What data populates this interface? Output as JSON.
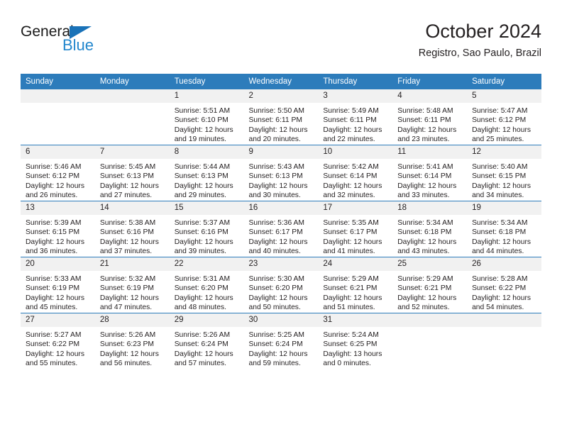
{
  "brand": {
    "name_top": "General",
    "name_bottom": "Blue"
  },
  "header": {
    "title": "October 2024",
    "subtitle": "Registro, Sao Paulo, Brazil"
  },
  "colors": {
    "header_blue": "#2d7cbb",
    "logo_blue": "#2387cd",
    "daynum_band": "#f1f1f1",
    "text": "#231f20"
  },
  "weekdays": [
    "Sunday",
    "Monday",
    "Tuesday",
    "Wednesday",
    "Thursday",
    "Friday",
    "Saturday"
  ],
  "weeks": [
    [
      {
        "day": "",
        "sunrise": "",
        "sunset": "",
        "daylight1": "",
        "daylight2": ""
      },
      {
        "day": "",
        "sunrise": "",
        "sunset": "",
        "daylight1": "",
        "daylight2": ""
      },
      {
        "day": "1",
        "sunrise": "Sunrise: 5:51 AM",
        "sunset": "Sunset: 6:10 PM",
        "daylight1": "Daylight: 12 hours",
        "daylight2": "and 19 minutes."
      },
      {
        "day": "2",
        "sunrise": "Sunrise: 5:50 AM",
        "sunset": "Sunset: 6:11 PM",
        "daylight1": "Daylight: 12 hours",
        "daylight2": "and 20 minutes."
      },
      {
        "day": "3",
        "sunrise": "Sunrise: 5:49 AM",
        "sunset": "Sunset: 6:11 PM",
        "daylight1": "Daylight: 12 hours",
        "daylight2": "and 22 minutes."
      },
      {
        "day": "4",
        "sunrise": "Sunrise: 5:48 AM",
        "sunset": "Sunset: 6:11 PM",
        "daylight1": "Daylight: 12 hours",
        "daylight2": "and 23 minutes."
      },
      {
        "day": "5",
        "sunrise": "Sunrise: 5:47 AM",
        "sunset": "Sunset: 6:12 PM",
        "daylight1": "Daylight: 12 hours",
        "daylight2": "and 25 minutes."
      }
    ],
    [
      {
        "day": "6",
        "sunrise": "Sunrise: 5:46 AM",
        "sunset": "Sunset: 6:12 PM",
        "daylight1": "Daylight: 12 hours",
        "daylight2": "and 26 minutes."
      },
      {
        "day": "7",
        "sunrise": "Sunrise: 5:45 AM",
        "sunset": "Sunset: 6:13 PM",
        "daylight1": "Daylight: 12 hours",
        "daylight2": "and 27 minutes."
      },
      {
        "day": "8",
        "sunrise": "Sunrise: 5:44 AM",
        "sunset": "Sunset: 6:13 PM",
        "daylight1": "Daylight: 12 hours",
        "daylight2": "and 29 minutes."
      },
      {
        "day": "9",
        "sunrise": "Sunrise: 5:43 AM",
        "sunset": "Sunset: 6:13 PM",
        "daylight1": "Daylight: 12 hours",
        "daylight2": "and 30 minutes."
      },
      {
        "day": "10",
        "sunrise": "Sunrise: 5:42 AM",
        "sunset": "Sunset: 6:14 PM",
        "daylight1": "Daylight: 12 hours",
        "daylight2": "and 32 minutes."
      },
      {
        "day": "11",
        "sunrise": "Sunrise: 5:41 AM",
        "sunset": "Sunset: 6:14 PM",
        "daylight1": "Daylight: 12 hours",
        "daylight2": "and 33 minutes."
      },
      {
        "day": "12",
        "sunrise": "Sunrise: 5:40 AM",
        "sunset": "Sunset: 6:15 PM",
        "daylight1": "Daylight: 12 hours",
        "daylight2": "and 34 minutes."
      }
    ],
    [
      {
        "day": "13",
        "sunrise": "Sunrise: 5:39 AM",
        "sunset": "Sunset: 6:15 PM",
        "daylight1": "Daylight: 12 hours",
        "daylight2": "and 36 minutes."
      },
      {
        "day": "14",
        "sunrise": "Sunrise: 5:38 AM",
        "sunset": "Sunset: 6:16 PM",
        "daylight1": "Daylight: 12 hours",
        "daylight2": "and 37 minutes."
      },
      {
        "day": "15",
        "sunrise": "Sunrise: 5:37 AM",
        "sunset": "Sunset: 6:16 PM",
        "daylight1": "Daylight: 12 hours",
        "daylight2": "and 39 minutes."
      },
      {
        "day": "16",
        "sunrise": "Sunrise: 5:36 AM",
        "sunset": "Sunset: 6:17 PM",
        "daylight1": "Daylight: 12 hours",
        "daylight2": "and 40 minutes."
      },
      {
        "day": "17",
        "sunrise": "Sunrise: 5:35 AM",
        "sunset": "Sunset: 6:17 PM",
        "daylight1": "Daylight: 12 hours",
        "daylight2": "and 41 minutes."
      },
      {
        "day": "18",
        "sunrise": "Sunrise: 5:34 AM",
        "sunset": "Sunset: 6:18 PM",
        "daylight1": "Daylight: 12 hours",
        "daylight2": "and 43 minutes."
      },
      {
        "day": "19",
        "sunrise": "Sunrise: 5:34 AM",
        "sunset": "Sunset: 6:18 PM",
        "daylight1": "Daylight: 12 hours",
        "daylight2": "and 44 minutes."
      }
    ],
    [
      {
        "day": "20",
        "sunrise": "Sunrise: 5:33 AM",
        "sunset": "Sunset: 6:19 PM",
        "daylight1": "Daylight: 12 hours",
        "daylight2": "and 45 minutes."
      },
      {
        "day": "21",
        "sunrise": "Sunrise: 5:32 AM",
        "sunset": "Sunset: 6:19 PM",
        "daylight1": "Daylight: 12 hours",
        "daylight2": "and 47 minutes."
      },
      {
        "day": "22",
        "sunrise": "Sunrise: 5:31 AM",
        "sunset": "Sunset: 6:20 PM",
        "daylight1": "Daylight: 12 hours",
        "daylight2": "and 48 minutes."
      },
      {
        "day": "23",
        "sunrise": "Sunrise: 5:30 AM",
        "sunset": "Sunset: 6:20 PM",
        "daylight1": "Daylight: 12 hours",
        "daylight2": "and 50 minutes."
      },
      {
        "day": "24",
        "sunrise": "Sunrise: 5:29 AM",
        "sunset": "Sunset: 6:21 PM",
        "daylight1": "Daylight: 12 hours",
        "daylight2": "and 51 minutes."
      },
      {
        "day": "25",
        "sunrise": "Sunrise: 5:29 AM",
        "sunset": "Sunset: 6:21 PM",
        "daylight1": "Daylight: 12 hours",
        "daylight2": "and 52 minutes."
      },
      {
        "day": "26",
        "sunrise": "Sunrise: 5:28 AM",
        "sunset": "Sunset: 6:22 PM",
        "daylight1": "Daylight: 12 hours",
        "daylight2": "and 54 minutes."
      }
    ],
    [
      {
        "day": "27",
        "sunrise": "Sunrise: 5:27 AM",
        "sunset": "Sunset: 6:22 PM",
        "daylight1": "Daylight: 12 hours",
        "daylight2": "and 55 minutes."
      },
      {
        "day": "28",
        "sunrise": "Sunrise: 5:26 AM",
        "sunset": "Sunset: 6:23 PM",
        "daylight1": "Daylight: 12 hours",
        "daylight2": "and 56 minutes."
      },
      {
        "day": "29",
        "sunrise": "Sunrise: 5:26 AM",
        "sunset": "Sunset: 6:24 PM",
        "daylight1": "Daylight: 12 hours",
        "daylight2": "and 57 minutes."
      },
      {
        "day": "30",
        "sunrise": "Sunrise: 5:25 AM",
        "sunset": "Sunset: 6:24 PM",
        "daylight1": "Daylight: 12 hours",
        "daylight2": "and 59 minutes."
      },
      {
        "day": "31",
        "sunrise": "Sunrise: 5:24 AM",
        "sunset": "Sunset: 6:25 PM",
        "daylight1": "Daylight: 13 hours",
        "daylight2": "and 0 minutes."
      },
      {
        "day": "",
        "sunrise": "",
        "sunset": "",
        "daylight1": "",
        "daylight2": ""
      },
      {
        "day": "",
        "sunrise": "",
        "sunset": "",
        "daylight1": "",
        "daylight2": ""
      }
    ]
  ]
}
